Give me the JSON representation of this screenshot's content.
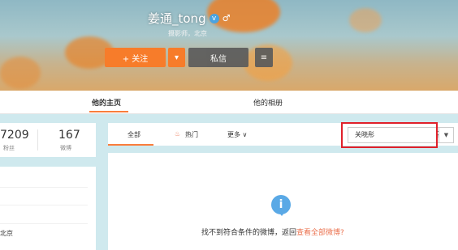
{
  "profile": {
    "username": "姜通_tong",
    "meta": "摄影师，北京",
    "follow_label": "+ 关注",
    "message_label": "私信"
  },
  "tabs": {
    "home": "他的主页",
    "album": "他的相册"
  },
  "stats": {
    "fans_value": "7209",
    "fans_label": "粉丝",
    "weibo_value": "167",
    "weibo_label": "微博"
  },
  "info": {
    "city": "北京"
  },
  "filter": {
    "all": "全部",
    "hot": "热门",
    "more": "更多 ∨"
  },
  "search": {
    "value": "关晓彤"
  },
  "empty": {
    "message": "找不到符合条件的微博，返回",
    "link": "查看全部微博?"
  },
  "colors": {
    "accent": "#f77c2a",
    "highlight": "#e0202a",
    "info": "#5aa9e6"
  },
  "icons": {
    "vip": "verified-icon",
    "search": "search-icon",
    "info": "info-icon",
    "hot": "fire-icon"
  }
}
